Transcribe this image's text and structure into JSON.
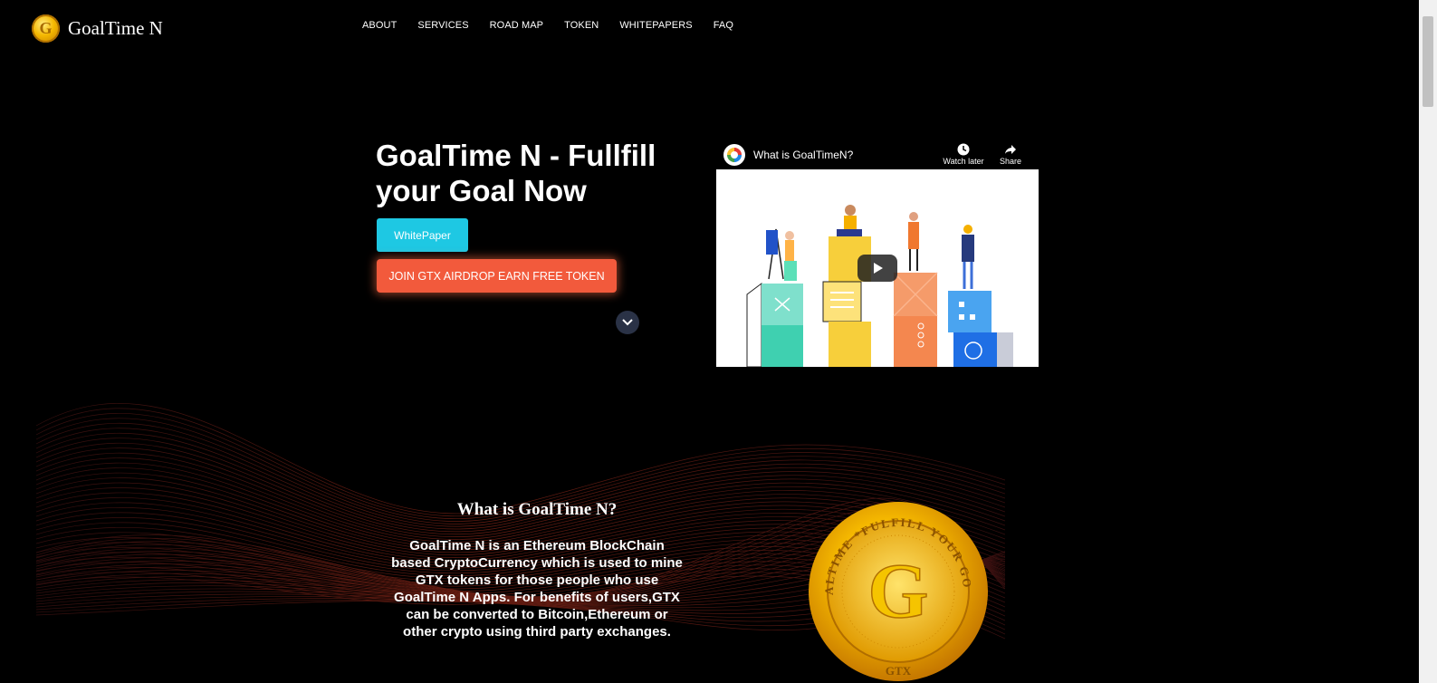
{
  "header": {
    "brand": "GoalTime N",
    "logo_letter": "G",
    "nav": [
      "ABOUT",
      "SERVICES",
      "ROAD MAP",
      "TOKEN",
      "WHITEPAPERS",
      "FAQ"
    ]
  },
  "hero": {
    "title": "GoalTime N - Fullfill your Goal Now",
    "whitepaper_button": "WhitePaper",
    "airdrop_button": "JOIN GTX AIRDROP EARN FREE TOKEN"
  },
  "video": {
    "title": "What is GoalTimeN?",
    "watch_later": "Watch later",
    "share": "Share"
  },
  "about": {
    "heading": "What is GoalTime N?",
    "text": "GoalTime N is an Ethereum BlockChain based CryptoCurrency which is used to mine GTX tokens for those people who use GoalTime N Apps. For benefits of users,GTX can be converted to Bitcoin,Ethereum or other crypto using third party exchanges."
  },
  "coin": {
    "top_text": "GOALTIME *FULFILL YOUR GOAL*",
    "letter": "G",
    "bottom_text": "GTX"
  },
  "colors": {
    "accent_cyan": "#1ec8e3",
    "accent_orange": "#f25a3c",
    "gold": "#f5b800"
  }
}
